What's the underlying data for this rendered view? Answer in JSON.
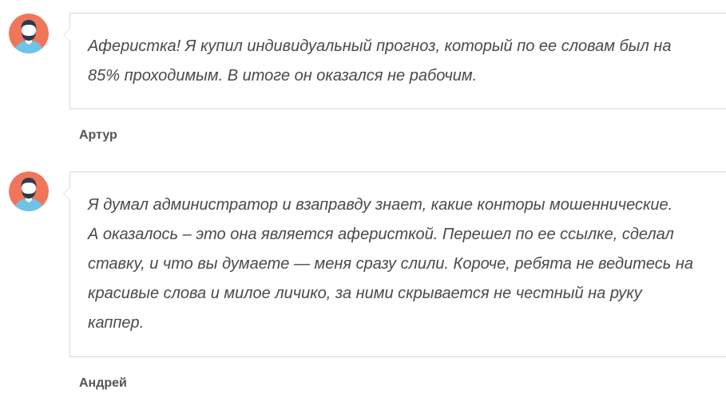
{
  "comments": [
    {
      "text_lines": [
        "Аферистка! Я купил индивидуальный прогноз, который по ее словам был на",
        "85% проходимым. В итоге он оказался не рабочим."
      ],
      "author": "Артур",
      "avatar_icon": "user-avatar-icon"
    },
    {
      "text_lines": [
        "Я думал администратор и взаправду знает, какие конторы мошеннические.",
        "А оказалось – это она является аферисткой. Перешел по ее ссылке, сделал",
        "ставку, и что вы думаете — меня сразу слили. Короче, ребята не ведитесь на",
        "красивые слова и милое личико, за ними скрывается не честный на руку",
        "каппер."
      ],
      "author": "Андрей",
      "avatar_icon": "user-avatar-icon"
    }
  ],
  "colors": {
    "avatar_bg": "#f0765a",
    "avatar_shirt": "#6cc4e8",
    "avatar_skin": "#ffffff",
    "avatar_hair": "#2f3a4a",
    "border": "#d9d9d9",
    "text": "#4a4a4a",
    "author": "#555555"
  }
}
